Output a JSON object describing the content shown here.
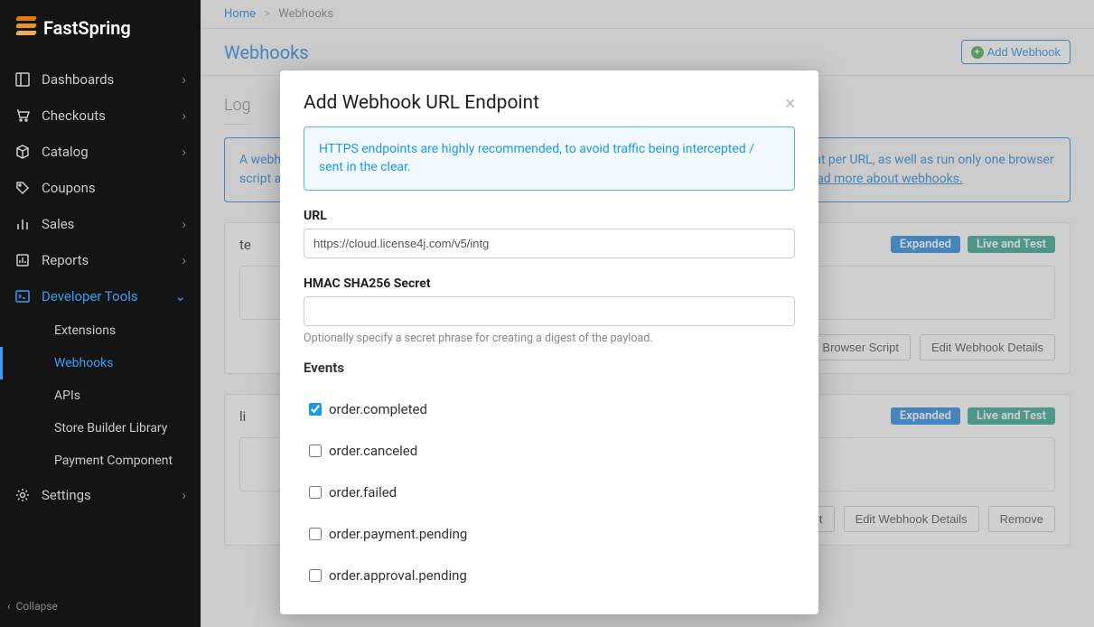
{
  "brand": "FastSpring",
  "sidebar": {
    "items": [
      {
        "label": "Dashboards",
        "icon": "dashboard-icon",
        "hasSub": true
      },
      {
        "label": "Checkouts",
        "icon": "cart-icon",
        "hasSub": true
      },
      {
        "label": "Catalog",
        "icon": "box-icon",
        "hasSub": true
      },
      {
        "label": "Coupons",
        "icon": "tag-icon",
        "hasSub": false
      },
      {
        "label": "Sales",
        "icon": "chart-icon",
        "hasSub": true
      },
      {
        "label": "Reports",
        "icon": "report-icon",
        "hasSub": true
      },
      {
        "label": "Developer Tools",
        "icon": "terminal-icon",
        "hasSub": true,
        "expanded": true
      },
      {
        "label": "Settings",
        "icon": "gear-icon",
        "hasSub": true
      }
    ],
    "devtoolsSub": [
      {
        "label": "Extensions"
      },
      {
        "label": "Webhooks",
        "active": true
      },
      {
        "label": "APIs"
      },
      {
        "label": "Store Builder Library"
      },
      {
        "label": "Payment Component"
      }
    ],
    "collapse": "Collapse"
  },
  "breadcrumb": {
    "home": "Home",
    "sep": ">",
    "current": "Webhooks"
  },
  "header": {
    "title": "Webhooks",
    "addButton": "Add Webhook"
  },
  "sectionLabel": "Log",
  "banner": {
    "text": "A webhook is a single HTTP POST message sent out when an event occurs. You can only have one event per URL, as well as run only one browser script at a time. We recommend using one global webhook, instead of multiple individual webhooks. ",
    "linkText": "Read more about webhooks."
  },
  "cards": [
    {
      "name": "te",
      "badges": [
        "Expanded",
        "Live and Test"
      ],
      "actions": [
        "Add Browser Script",
        "Edit Webhook Details"
      ]
    },
    {
      "name": "li",
      "badges": [
        "Expanded",
        "Live and Test"
      ],
      "actions": [
        "Add Browser Script",
        "Edit Webhook Details",
        "Remove"
      ]
    }
  ],
  "modal": {
    "title": "Add Webhook URL Endpoint",
    "alert": "HTTPS endpoints are highly recommended, to avoid traffic being intercepted / sent in the clear.",
    "urlLabel": "URL",
    "urlValue": "https://cloud.license4j.com/v5/intg",
    "secretLabel": "HMAC SHA256 Secret",
    "secretValue": "",
    "secretHelp": "Optionally specify a secret phrase for creating a digest of the payload.",
    "eventsLabel": "Events",
    "events": [
      {
        "label": "order.completed",
        "checked": true
      },
      {
        "label": "order.canceled",
        "checked": false
      },
      {
        "label": "order.failed",
        "checked": false
      },
      {
        "label": "order.payment.pending",
        "checked": false
      },
      {
        "label": "order.approval.pending",
        "checked": false
      }
    ]
  }
}
